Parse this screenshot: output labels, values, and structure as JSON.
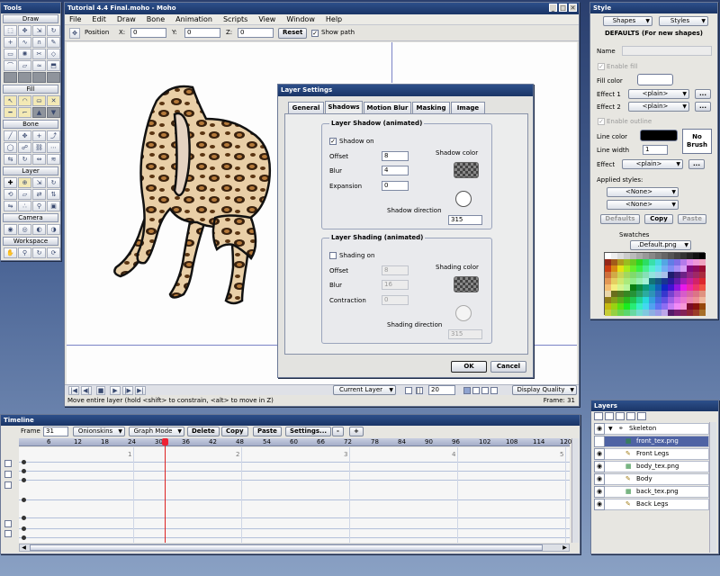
{
  "tools": {
    "title": "Tools",
    "draw": "Draw",
    "fill": "Fill",
    "bone": "Bone",
    "layer": "Layer",
    "camera": "Camera",
    "workspace": "Workspace"
  },
  "main": {
    "title": "Tutorial 4.4 Final.moho - Moho",
    "menu": [
      "File",
      "Edit",
      "Draw",
      "Bone",
      "Animation",
      "Scripts",
      "View",
      "Window",
      "Help"
    ],
    "toolbar": {
      "position": "Position",
      "x": "X:",
      "x_val": "0",
      "y": "Y:",
      "y_val": "0",
      "z": "Z:",
      "z_val": "0",
      "reset": "Reset",
      "show_path": "Show path"
    },
    "status": "Move entire layer (hold <shift> to constrain, <alt> to move in Z)",
    "frame_label": "Frame: 31",
    "current_layer": "Current Layer",
    "zoom": "20",
    "display_quality": "Display Quality"
  },
  "dialog": {
    "title": "Layer Settings",
    "tabs": [
      "General",
      "Shadows",
      "Motion Blur",
      "Masking",
      "Image"
    ],
    "shadow": {
      "title": "Layer Shadow (animated)",
      "on": "Shadow on",
      "offset": "Offset",
      "offset_val": "8",
      "blur": "Blur",
      "blur_val": "4",
      "expansion": "Expansion",
      "expansion_val": "0",
      "color": "Shadow color",
      "direction": "Shadow direction",
      "direction_val": "315"
    },
    "shading": {
      "title": "Layer Shading (animated)",
      "on": "Shading on",
      "offset": "Offset",
      "offset_val": "8",
      "blur": "Blur",
      "blur_val": "16",
      "contraction": "Contraction",
      "contraction_val": "0",
      "color": "Shading color",
      "direction": "Shading direction",
      "direction_val": "315"
    },
    "ok": "OK",
    "cancel": "Cancel"
  },
  "style": {
    "title": "Style",
    "shapes": "Shapes",
    "styles": "Styles",
    "defaults_heading": "DEFAULTS (For new shapes)",
    "name": "Name",
    "enable_fill": "Enable fill",
    "fill_color": "Fill color",
    "effect1": "Effect 1",
    "effect2": "Effect 2",
    "plain": "<plain>",
    "enable_outline": "Enable outline",
    "line_color": "Line color",
    "line_width": "Line width",
    "line_width_val": "1",
    "effect": "Effect",
    "no_brush": "No Brush",
    "applied_styles": "Applied styles:",
    "none": "<None>",
    "defaults_btn": "Defaults",
    "copy": "Copy",
    "paste": "Paste",
    "swatches": "Swatches",
    "swatch_file": ".Default.png",
    "more": "..."
  },
  "layers": {
    "title": "Layers",
    "items": [
      {
        "name": "Skeleton",
        "icon": "bone-group-icon"
      },
      {
        "name": "front_tex.png",
        "icon": "image-icon"
      },
      {
        "name": "Front Legs",
        "icon": "vector-icon"
      },
      {
        "name": "body_tex.png",
        "icon": "image-icon"
      },
      {
        "name": "Body",
        "icon": "vector-icon"
      },
      {
        "name": "back_tex.png",
        "icon": "image-icon"
      },
      {
        "name": "Back Legs",
        "icon": "vector-icon"
      }
    ]
  },
  "timeline": {
    "title": "Timeline",
    "frame": "Frame",
    "frame_val": "31",
    "onionskins": "Onionskins",
    "graph_mode": "Graph Mode",
    "delete": "Delete",
    "copy": "Copy",
    "paste": "Paste",
    "settings": "Settings...",
    "minus": "-",
    "plus": "+",
    "ruler": [
      "6",
      "12",
      "18",
      "24",
      "30",
      "36",
      "42",
      "48",
      "54",
      "60",
      "66",
      "72",
      "78",
      "84",
      "90",
      "96",
      "102",
      "108",
      "114",
      "120"
    ],
    "seconds": [
      "1",
      "2",
      "3",
      "4",
      "5"
    ]
  },
  "colors": {
    "title_bar": "#1a3566",
    "selection": "#4f63a4"
  }
}
